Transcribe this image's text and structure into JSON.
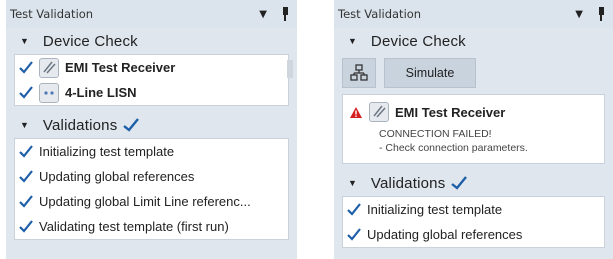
{
  "left_panel": {
    "title": "Test Validation",
    "device_check": {
      "label": "Device Check",
      "devices": [
        {
          "name": "EMI Test Receiver",
          "icon": "receiver-icon"
        },
        {
          "name": "4-Line LISN",
          "icon": "lisn-icon"
        }
      ]
    },
    "validations": {
      "label": "Validations",
      "items": [
        "Initializing test template",
        "Updating global references",
        "Updating global Limit Line referenc...",
        "Validating test template (first run)"
      ]
    }
  },
  "right_panel": {
    "title": "Test Validation",
    "device_check": {
      "label": "Device Check",
      "simulate_label": "Simulate",
      "error_device": "EMI Test Receiver",
      "error_title": "CONNECTION FAILED!",
      "error_hint": "- Check connection parameters."
    },
    "validations": {
      "label": "Validations",
      "items": [
        "Initializing test template",
        "Updating global references"
      ]
    }
  },
  "colors": {
    "check": "#1f5fa8",
    "warning": "#d42020",
    "panel_bg": "#dfe6ee"
  }
}
